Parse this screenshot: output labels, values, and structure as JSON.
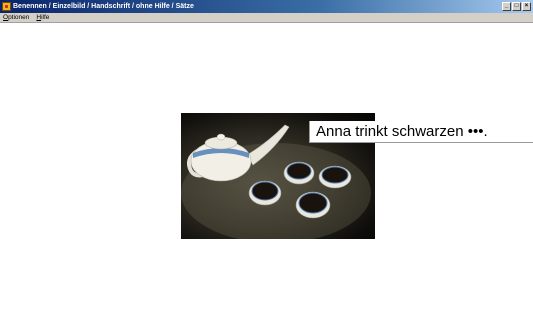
{
  "window": {
    "title": "Benennen / Einzelbild / Handschrift / ohne Hilfe / Sätze",
    "buttons": {
      "minimize": "_",
      "maximize": "□",
      "close": "×"
    }
  },
  "menu": {
    "items": [
      {
        "accel": "O",
        "rest": "ptionen"
      },
      {
        "accel": "H",
        "rest": "ilfe"
      }
    ]
  },
  "exercise": {
    "image_icon": "teapot-with-cups-photo",
    "sentence": "Anna trinkt schwarzen •••."
  }
}
